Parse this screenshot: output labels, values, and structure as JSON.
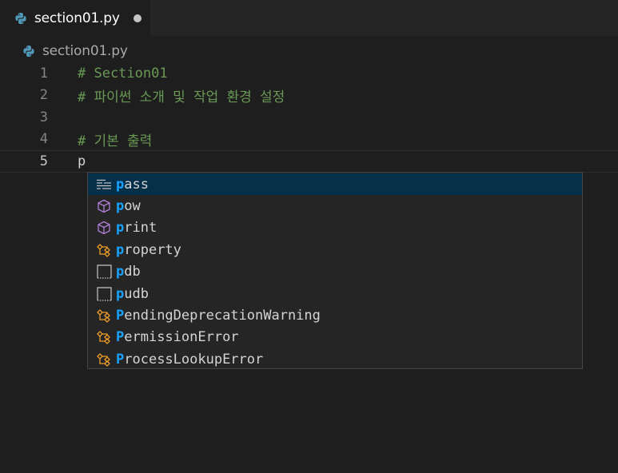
{
  "tab": {
    "title": "section01.py"
  },
  "breadcrumb": {
    "file": "section01.py"
  },
  "editor": {
    "lines": [
      {
        "number": "1",
        "text": "# Section01",
        "kind": "comment"
      },
      {
        "number": "2",
        "text": "# 파이썬 소개 및 작업 환경 설정",
        "kind": "comment"
      },
      {
        "number": "3",
        "text": "",
        "kind": "blank"
      },
      {
        "number": "4",
        "text": "# 기본 출력",
        "kind": "comment"
      },
      {
        "number": "5",
        "text": "p",
        "kind": "code"
      }
    ]
  },
  "suggest": {
    "typed": "p",
    "items": [
      {
        "match": "p",
        "rest": "ass",
        "icon": "keyword-icon",
        "selected": true
      },
      {
        "match": "p",
        "rest": "ow",
        "icon": "method-cube-icon"
      },
      {
        "match": "p",
        "rest": "rint",
        "icon": "method-cube-icon"
      },
      {
        "match": "p",
        "rest": "roperty",
        "icon": "class-icon"
      },
      {
        "match": "p",
        "rest": "db",
        "icon": "module-icon"
      },
      {
        "match": "p",
        "rest": "udb",
        "icon": "module-icon"
      },
      {
        "match": "P",
        "rest": "endingDeprecationWarning",
        "icon": "class-icon"
      },
      {
        "match": "P",
        "rest": "ermissionError",
        "icon": "class-icon"
      },
      {
        "match": "P",
        "rest": "rocessLookupError",
        "icon": "class-icon"
      }
    ]
  },
  "colors": {
    "background": "#1e1e1e",
    "comment": "#6a9955",
    "match_highlight": "#18a3ff",
    "selection": "#062f4a",
    "class_icon": "#ee9d28",
    "method_icon": "#b180d7"
  }
}
